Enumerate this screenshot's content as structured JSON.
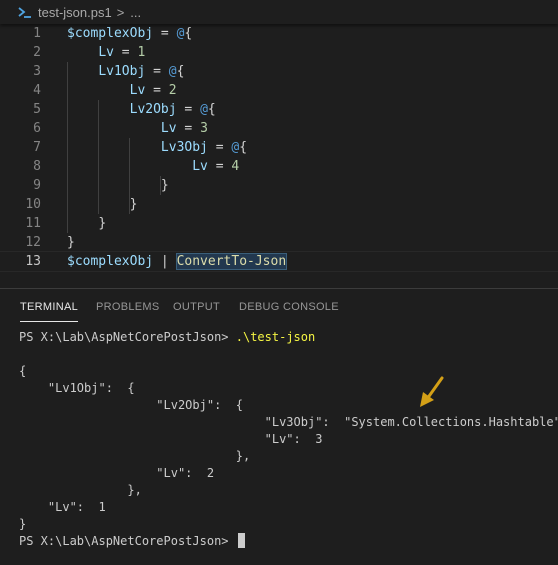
{
  "breadcrumb": {
    "file": "test-json.ps1",
    "separator": ">",
    "trail": "..."
  },
  "editor": {
    "lines": [
      {
        "num": "1",
        "active": false,
        "segments": [
          {
            "t": "$complexObj",
            "c": "var"
          },
          {
            "t": " = ",
            "c": "op"
          },
          {
            "t": "@",
            "c": "at"
          },
          {
            "t": "{",
            "c": "op"
          }
        ]
      },
      {
        "num": "2",
        "active": false,
        "segments": [
          {
            "t": "    "
          },
          {
            "t": "Lv",
            "c": "var"
          },
          {
            "t": " = ",
            "c": "op"
          },
          {
            "t": "1",
            "c": "num"
          }
        ]
      },
      {
        "num": "3",
        "active": false,
        "segments": [
          {
            "t": "    "
          },
          {
            "t": "Lv1Obj",
            "c": "var"
          },
          {
            "t": " = ",
            "c": "op"
          },
          {
            "t": "@",
            "c": "at"
          },
          {
            "t": "{",
            "c": "op"
          }
        ]
      },
      {
        "num": "4",
        "active": false,
        "segments": [
          {
            "t": "        "
          },
          {
            "t": "Lv",
            "c": "var"
          },
          {
            "t": " = ",
            "c": "op"
          },
          {
            "t": "2",
            "c": "num"
          }
        ]
      },
      {
        "num": "5",
        "active": false,
        "segments": [
          {
            "t": "        "
          },
          {
            "t": "Lv2Obj",
            "c": "var"
          },
          {
            "t": " = ",
            "c": "op"
          },
          {
            "t": "@",
            "c": "at"
          },
          {
            "t": "{",
            "c": "op"
          }
        ]
      },
      {
        "num": "6",
        "active": false,
        "segments": [
          {
            "t": "            "
          },
          {
            "t": "Lv",
            "c": "var"
          },
          {
            "t": " = ",
            "c": "op"
          },
          {
            "t": "3",
            "c": "num"
          }
        ]
      },
      {
        "num": "7",
        "active": false,
        "segments": [
          {
            "t": "            "
          },
          {
            "t": "Lv3Obj",
            "c": "var"
          },
          {
            "t": " = ",
            "c": "op"
          },
          {
            "t": "@",
            "c": "at"
          },
          {
            "t": "{",
            "c": "op"
          }
        ]
      },
      {
        "num": "8",
        "active": false,
        "segments": [
          {
            "t": "                "
          },
          {
            "t": "Lv",
            "c": "var"
          },
          {
            "t": " = ",
            "c": "op"
          },
          {
            "t": "4",
            "c": "num"
          }
        ]
      },
      {
        "num": "9",
        "active": false,
        "segments": [
          {
            "t": "            "
          },
          {
            "t": "}",
            "c": "op"
          }
        ]
      },
      {
        "num": "10",
        "active": false,
        "segments": [
          {
            "t": "        "
          },
          {
            "t": "}",
            "c": "op"
          }
        ]
      },
      {
        "num": "11",
        "active": false,
        "segments": [
          {
            "t": "    "
          },
          {
            "t": "}",
            "c": "op"
          }
        ]
      },
      {
        "num": "12",
        "active": false,
        "segments": [
          {
            "t": "}",
            "c": "op"
          }
        ]
      },
      {
        "num": "13",
        "active": true,
        "segments": [
          {
            "t": "$complexObj",
            "c": "var"
          },
          {
            "t": " | ",
            "c": "op"
          },
          {
            "t": "ConvertTo-Json",
            "c": "cmd hl"
          }
        ]
      }
    ]
  },
  "panel": {
    "tabs": [
      {
        "label": "TERMINAL",
        "active": true
      },
      {
        "label": "PROBLEMS",
        "active": false
      },
      {
        "label": "OUTPUT",
        "active": false
      },
      {
        "label": "DEBUG CONSOLE",
        "active": false
      }
    ]
  },
  "terminal": {
    "prompt": "PS X:\\Lab\\AspNetCorePostJson>",
    "command": ".\\test-json",
    "output": [
      "",
      "{",
      "    \"Lv1Obj\":  {",
      "                   \"Lv2Obj\":  {",
      "                                  \"Lv3Obj\":  \"System.Collections.Hashtable\",",
      "                                  \"Lv\":  3",
      "                              },",
      "                   \"Lv\":  2",
      "               },",
      "    \"Lv\":  1",
      "}"
    ],
    "final_prompt": "PS X:\\Lab\\AspNetCorePostJson>"
  },
  "colors": {
    "background": "#1e1e1e",
    "variable": "#9cdcfe",
    "number": "#b5cea8",
    "at_sign": "#569cd6",
    "command": "#dcdcaa",
    "terminal_command": "#f5f543",
    "arrow": "#d4a017"
  },
  "icons": {
    "file_icon": "powershell-icon",
    "annotation": "arrow-down-left-icon"
  }
}
